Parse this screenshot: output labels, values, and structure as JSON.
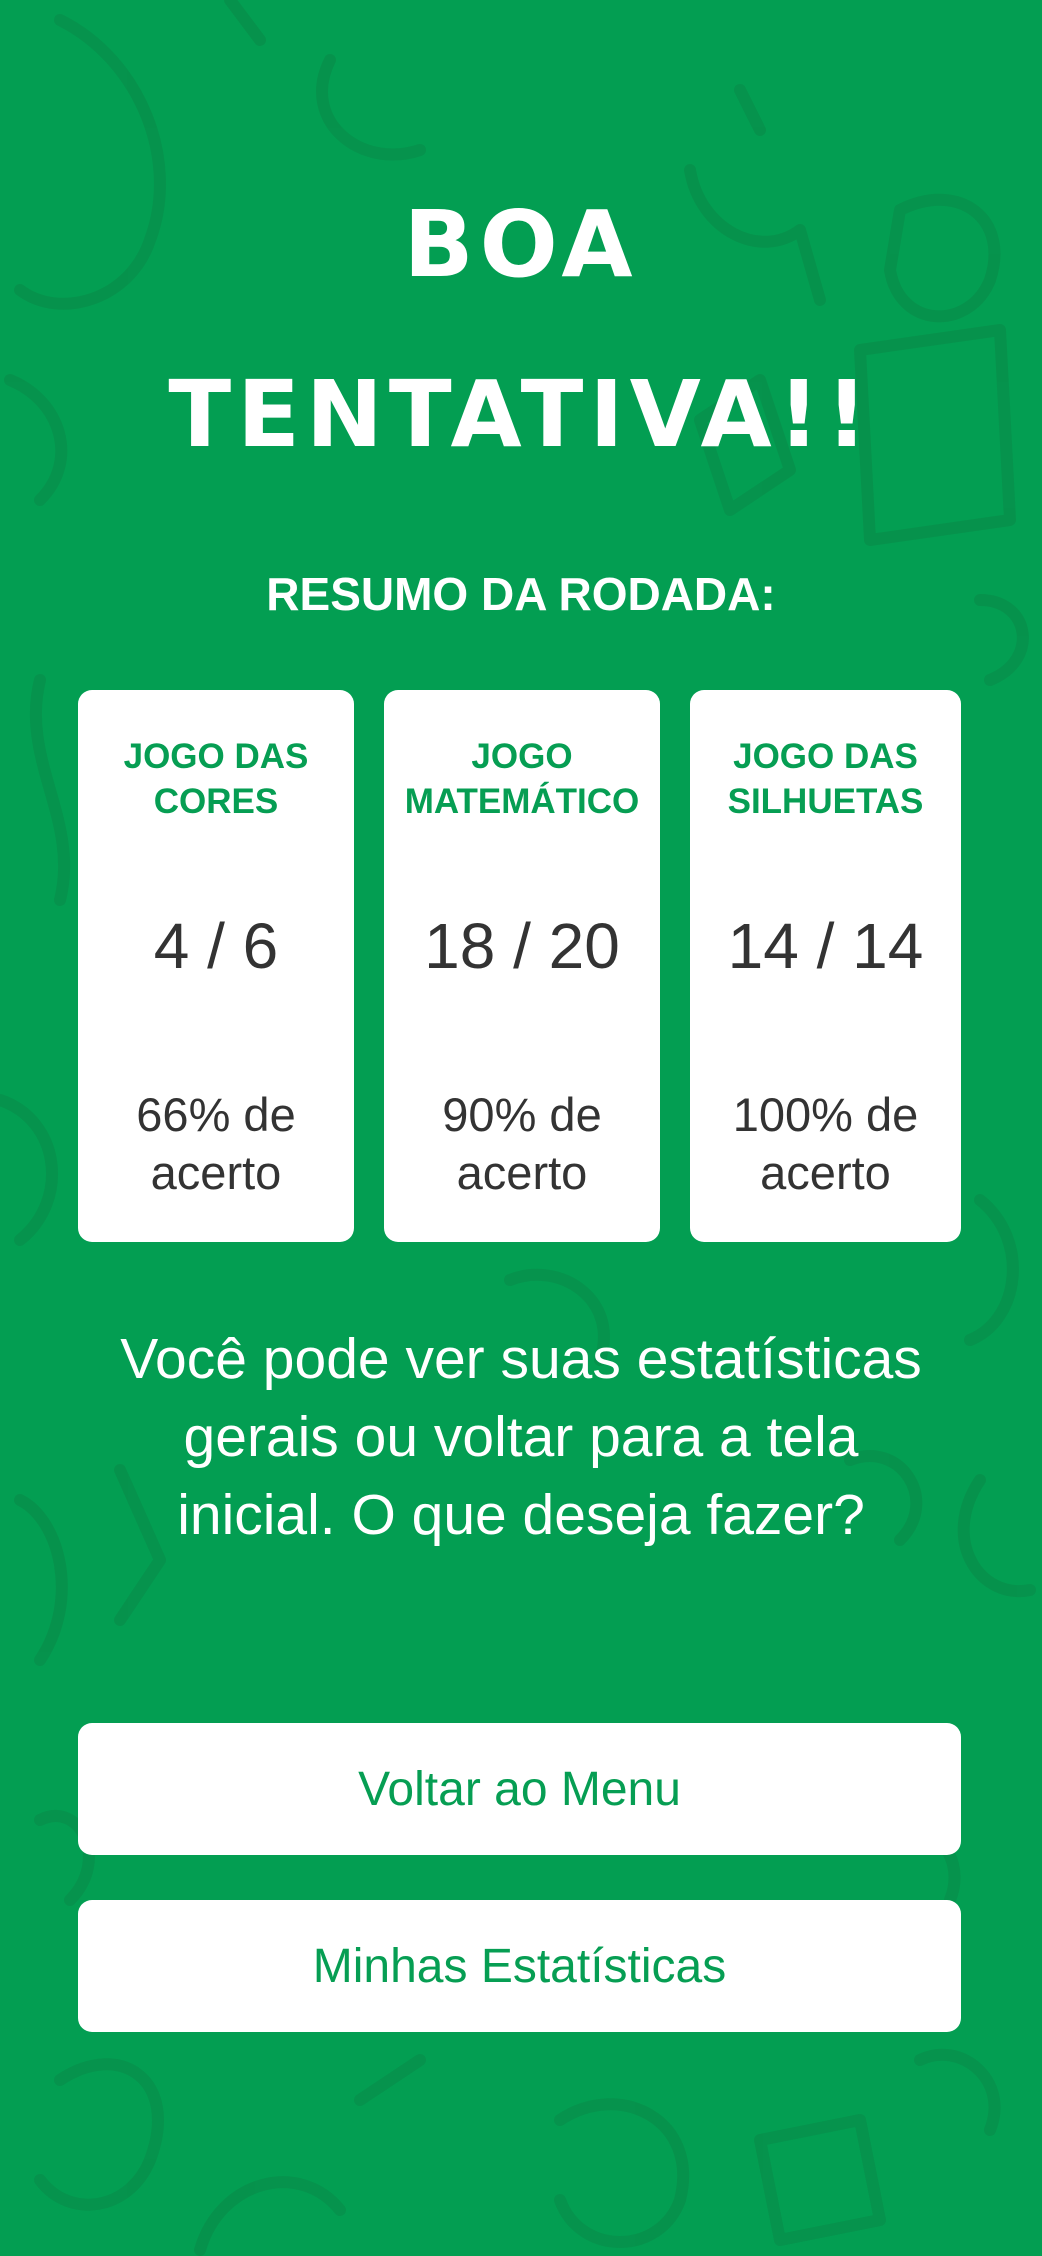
{
  "header": {
    "title_line_1": "BOA",
    "title_line_2": "TENTATIVA!!"
  },
  "summary": {
    "heading": "RESUMO DA RODADA:",
    "cards": [
      {
        "title": "JOGO DAS\nCORES",
        "score": "4 / 6",
        "accuracy": "66% de acerto"
      },
      {
        "title": "JOGO\nMATEMÁTICO",
        "score": "18 / 20",
        "accuracy": "90% de acerto"
      },
      {
        "title": "JOGO DAS\nSILHUETAS",
        "score": "14 / 14",
        "accuracy": "100% de acerto"
      }
    ]
  },
  "prompt": "Você pode ver suas estatísticas gerais ou voltar para a tela inicial. O que deseja fazer?",
  "buttons": {
    "back_to_menu": "Voltar ao Menu",
    "my_stats": "Minhas Estatísticas"
  },
  "colors": {
    "background": "#039e52",
    "accent_text": "#069e53",
    "card_bg": "#ffffff",
    "score_text": "#333333"
  }
}
